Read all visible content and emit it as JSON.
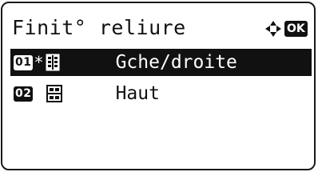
{
  "screen": {
    "title": "Finit° reliure",
    "ok_label": "OK"
  },
  "options": [
    {
      "number": "01",
      "marker": "*",
      "icon": "left-right-binding-icon",
      "label": "Gche/droite",
      "selected": true
    },
    {
      "number": "02",
      "marker": "",
      "icon": "top-binding-icon",
      "label": "Haut",
      "selected": false
    }
  ],
  "colors": {
    "foreground": "#111111",
    "background": "#ffffff"
  }
}
